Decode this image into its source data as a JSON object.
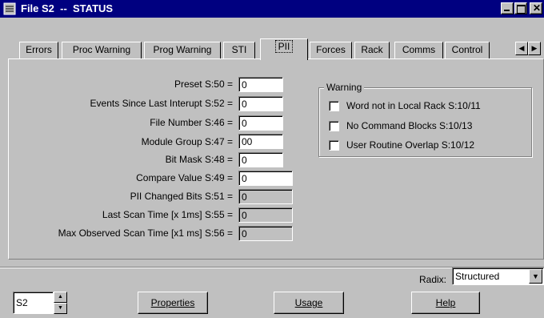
{
  "window": {
    "title": "File S2  --  STATUS",
    "icon": "file-status-icon"
  },
  "tabs": [
    {
      "label": "Errors",
      "active": false
    },
    {
      "label": "Proc Warning",
      "active": false
    },
    {
      "label": "Prog Warning",
      "active": false
    },
    {
      "label": "STI",
      "active": false
    },
    {
      "label": "PII",
      "active": true
    },
    {
      "label": "Forces",
      "active": false
    },
    {
      "label": "Rack",
      "active": false
    },
    {
      "label": "Comms",
      "active": false
    },
    {
      "label": "Control",
      "active": false
    }
  ],
  "pii": {
    "fields": [
      {
        "label": "Preset S:50 =",
        "value": "0"
      },
      {
        "label": "Events Since Last Interupt S:52 =",
        "value": "0"
      },
      {
        "label": "File Number S:46 =",
        "value": "0"
      },
      {
        "label": "Module Group S:47 =",
        "value": "00"
      },
      {
        "label": "Bit Mask S:48 =",
        "value": "0"
      },
      {
        "label": "Compare Value S:49 =",
        "value": "0"
      },
      {
        "label": "PII Changed Bits S:51 =",
        "value": "0"
      },
      {
        "label": "Last Scan Time [x 1ms] S:55 =",
        "value": "0"
      },
      {
        "label": "Max Observed Scan Time [x1 ms] S:56 =",
        "value": "0"
      }
    ],
    "warning": {
      "title": "Warning",
      "items": [
        {
          "label": "Word not in Local Rack S:10/11",
          "checked": false
        },
        {
          "label": "No Command Blocks S:10/13",
          "checked": false
        },
        {
          "label": "User Routine Overlap S:10/12",
          "checked": false
        }
      ]
    }
  },
  "footer": {
    "radix_label": "Radix:",
    "radix_value": "Structured",
    "file_value": "S2",
    "properties_label": "Properties",
    "usage_label": "Usage",
    "help_label": "Help"
  }
}
